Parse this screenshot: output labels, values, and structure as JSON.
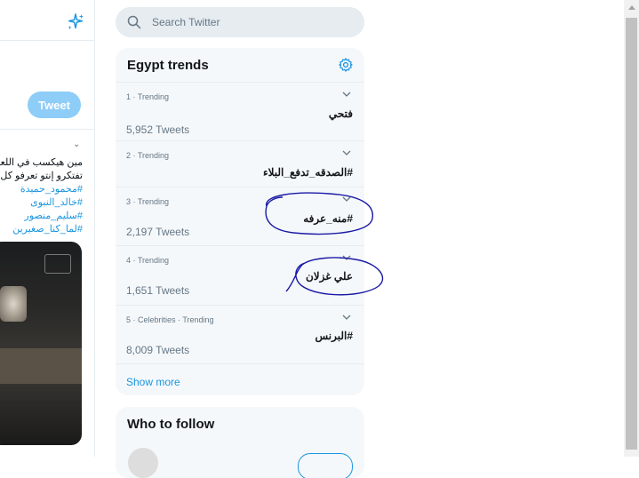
{
  "left_column": {
    "tweet_button_label": "Tweet",
    "tweet_lines": [
      "مين هيكسب في اللعبه!",
      "تفتكرو إنتو تعرفو كل ح"
    ],
    "hashtags": [
      "#محمود_حميدة",
      "#خالد_النبوى",
      "#سليم_منصور",
      "#لما_كنا_صغيرين"
    ]
  },
  "search": {
    "placeholder": "Search Twitter"
  },
  "trends": {
    "title": "Egypt trends",
    "items": [
      {
        "meta": "1 · Trending",
        "name": "فتحي",
        "count": "5,952 Tweets"
      },
      {
        "meta": "2 · Trending",
        "name": "#الصدقه_تدفع_البلاء",
        "count": ""
      },
      {
        "meta": "3 · Trending",
        "name": "#منه_عرفه",
        "count": "2,197 Tweets"
      },
      {
        "meta": "4 · Trending",
        "name": "علي غزلان",
        "count": "1,651 Tweets"
      },
      {
        "meta": "5 · Celebrities · Trending",
        "name": "#البرنس",
        "count": "8,009 Tweets"
      }
    ],
    "show_more": "Show more"
  },
  "who_to_follow": {
    "title": "Who to follow"
  },
  "colors": {
    "accent": "#1b95e0",
    "panel_bg": "#f5f8fa",
    "annotation": "#1a1aa6"
  }
}
